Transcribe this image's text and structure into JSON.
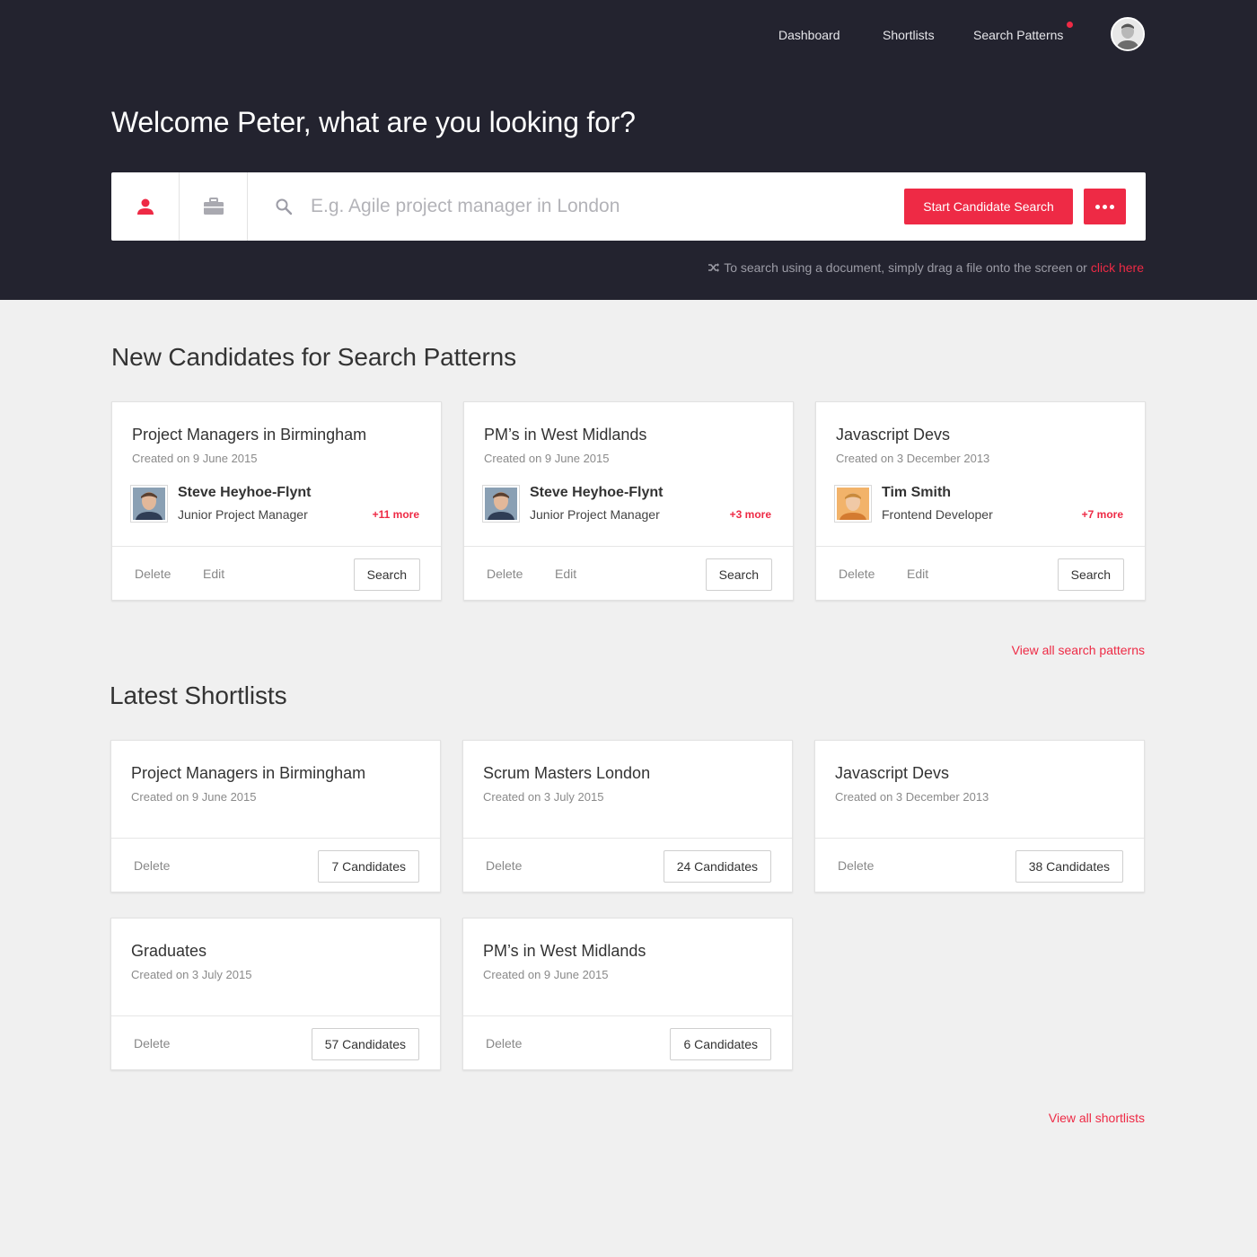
{
  "nav": {
    "items": [
      "Dashboard",
      "Shortlists",
      "Search Patterns"
    ]
  },
  "hero": {
    "welcome": "Welcome Peter, what are you looking for?",
    "search_placeholder": "E.g. Agile project manager in London",
    "start_button": "Start Candidate Search",
    "hint_text": "To search using a document, simply drag a file onto the screen or",
    "hint_link": "click here"
  },
  "colors": {
    "header_bg": "#23232f",
    "accent": "#ee2a45",
    "page_bg": "#f0f0f0"
  },
  "search_patterns": {
    "title": "New Candidates for Search Patterns",
    "view_all": "View all search patterns",
    "delete_label": "Delete",
    "edit_label": "Edit",
    "search_label": "Search",
    "cards": [
      {
        "title": "Project Managers in Birmingham",
        "date": "Created on 9 June 2015",
        "candidate": "Steve Heyhoe-Flynt",
        "role": "Junior Project Manager",
        "more": "+11 more"
      },
      {
        "title": "PM’s in West Midlands",
        "date": "Created on 9 June 2015",
        "candidate": "Steve Heyhoe-Flynt",
        "role": "Junior Project Manager",
        "more": "+3 more"
      },
      {
        "title": "Javascript Devs",
        "date": "Created on 3 December 2013",
        "candidate": "Tim Smith",
        "role": "Frontend Developer",
        "more": "+7 more"
      }
    ]
  },
  "shortlists": {
    "title": "Latest Shortlists",
    "view_all": "View all shortlists",
    "delete_label": "Delete",
    "cards": [
      {
        "title": "Project Managers in Birmingham",
        "date": "Created on 9 June 2015",
        "count": "7 Candidates"
      },
      {
        "title": "Scrum Masters London",
        "date": "Created on 3 July 2015",
        "count": "24 Candidates"
      },
      {
        "title": "Javascript Devs",
        "date": "Created on 3 December 2013",
        "count": "38 Candidates"
      },
      {
        "title": "Graduates",
        "date": "Created on 3 July 2015",
        "count": "57 Candidates"
      },
      {
        "title": "PM’s in West Midlands",
        "date": "Created on 9 June 2015",
        "count": "6 Candidates"
      }
    ]
  }
}
